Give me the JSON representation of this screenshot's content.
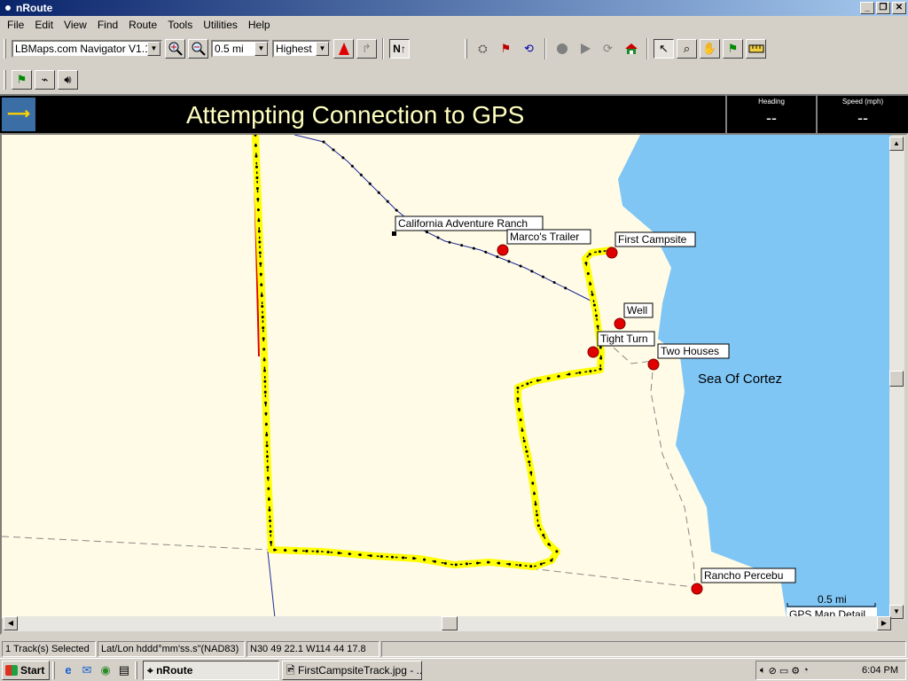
{
  "window": {
    "title": "nRoute"
  },
  "menu": [
    "File",
    "Edit",
    "View",
    "Find",
    "Route",
    "Tools",
    "Utilities",
    "Help"
  ],
  "toolbar": {
    "source_select": "LBMaps.com Navigator V1.10",
    "scale_select": "0.5 mi",
    "detail_select": "Highest",
    "north_up_label": "N↑"
  },
  "banner": {
    "message": "Attempting Connection to GPS",
    "heading_label": "Heading",
    "heading_value": "--",
    "speed_label": "Speed (mph)",
    "speed_value": "--"
  },
  "map": {
    "places": [
      {
        "name": "California Adventure Ranch",
        "type": "square"
      },
      {
        "name": "Marco's Trailer",
        "type": "waypoint"
      },
      {
        "name": "First Campsite",
        "type": "waypoint"
      },
      {
        "name": "Well",
        "type": "waypoint"
      },
      {
        "name": "Tight Turn",
        "type": "waypoint"
      },
      {
        "name": "Two Houses",
        "type": "waypoint"
      },
      {
        "name": "Rancho Percebu",
        "type": "waypoint"
      }
    ],
    "water_label": "Sea Of Cortez",
    "scale_label": "0.5 mi",
    "detail_label": "GPS Map Detail",
    "colors": {
      "land": "#fffbe6",
      "water": "#7fc6f5",
      "track": "#ffff00",
      "waypoint": "#e00000"
    }
  },
  "status": {
    "selection": "1 Track(s) Selected",
    "format": "Lat/Lon hddd°mm'ss.s\"(NAD83)",
    "coords": "N30 49 22.1 W114 44 17.8"
  },
  "taskbar": {
    "start": "Start",
    "tasks": [
      "nRoute",
      "FirstCampsiteTrack.jpg - ..."
    ],
    "clock": "6:04 PM"
  }
}
